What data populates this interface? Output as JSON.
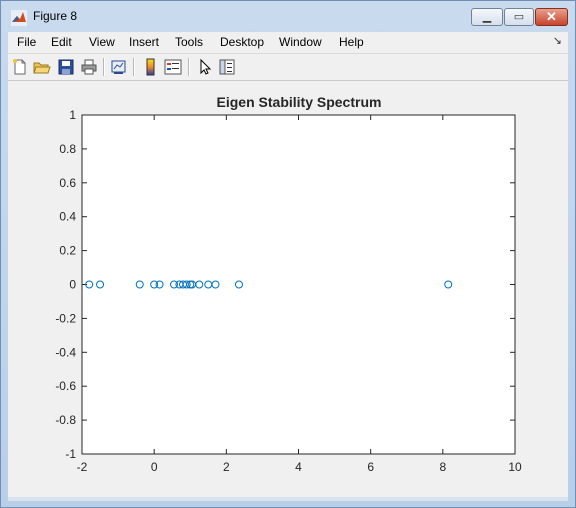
{
  "window": {
    "title": "Figure 8"
  },
  "menu": [
    "File",
    "Edit",
    "View",
    "Insert",
    "Tools",
    "Desktop",
    "Window",
    "Help"
  ],
  "toolbar": [
    "new-figure-icon",
    "open-icon",
    "save-icon",
    "print-icon",
    "link-plot-icon",
    "colorbar-icon",
    "legend-icon",
    "pointer-icon",
    "property-editor-icon"
  ],
  "chart_data": {
    "type": "scatter",
    "title": "Eigen Stability Spectrum",
    "xlabel": "",
    "ylabel": "",
    "xlim": [
      -2,
      10
    ],
    "ylim": [
      -1,
      1
    ],
    "xticks": [
      -2,
      0,
      2,
      4,
      6,
      8,
      10
    ],
    "yticks": [
      1,
      0.8,
      0.6,
      0.4,
      0.2,
      0,
      -0.2,
      -0.4,
      -0.6,
      -0.8,
      -1
    ],
    "marker": "circle",
    "marker_color": "#0072bd",
    "grid": false,
    "series": [
      {
        "x": [
          -1.8,
          -1.5,
          -0.4,
          0.0,
          0.15,
          0.55,
          0.7,
          0.8,
          0.9,
          1.0,
          1.05,
          1.25,
          1.5,
          1.7,
          2.35,
          8.15
        ],
        "y": [
          0,
          0,
          0,
          0,
          0,
          0,
          0,
          0,
          0,
          0,
          0,
          0,
          0,
          0,
          0,
          0
        ]
      }
    ]
  }
}
